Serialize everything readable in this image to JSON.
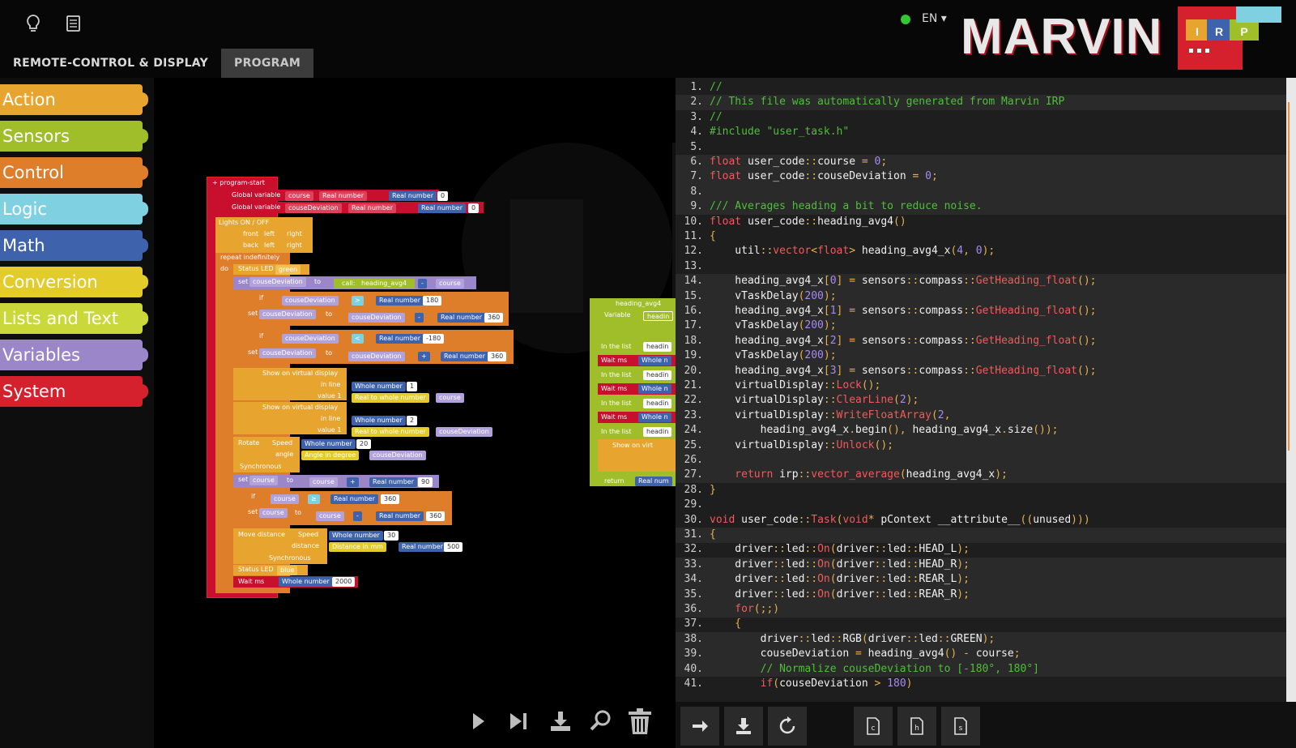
{
  "header": {
    "tabs": [
      {
        "label": "REMOTE-CONTROL & DISPLAY",
        "active": false
      },
      {
        "label": "PROGRAM",
        "active": true
      }
    ],
    "language": "EN",
    "connection_status_color": "#32c832",
    "logo_text": "MARVIN",
    "logo_badges": [
      "I",
      "R",
      "P"
    ],
    "icons": [
      "lightbulb-icon",
      "document-icon"
    ]
  },
  "palette": {
    "categories": [
      {
        "label": "Action",
        "color": "#e7a52f"
      },
      {
        "label": "Sensors",
        "color": "#9fbe2a"
      },
      {
        "label": "Control",
        "color": "#de7d2a"
      },
      {
        "label": "Logic",
        "color": "#7fd1e2"
      },
      {
        "label": "Math",
        "color": "#3f62ad"
      },
      {
        "label": "Conversion",
        "color": "#e3cc2a"
      },
      {
        "label": "Lists and Text",
        "color": "#cbd83a"
      },
      {
        "label": "Variables",
        "color": "#9a86c9"
      },
      {
        "label": "System",
        "color": "#d5212e"
      }
    ]
  },
  "blocks": {
    "program_start": "program-start",
    "global_var_label": "Global variable",
    "var_course": "course",
    "var_couse_dev": "couseDeviation",
    "real_number": "Real number",
    "zero": "0",
    "lights_on_off": "Lights ON / OFF",
    "front": "front",
    "back": "back",
    "left": "left",
    "right": "right",
    "repeat": "repeat indefinitely",
    "do": "do",
    "status_led": "Status LED",
    "green": "green",
    "blue": "blue",
    "set": "set",
    "to": "to",
    "call": "call:",
    "heading_avg4": "heading_avg4",
    "if": "if",
    "gt": ">",
    "lt": "<",
    "gte": "≥",
    "n180": "180",
    "n360": "360",
    "nm180": "-180",
    "n90": "90",
    "n20": "20",
    "n30": "30",
    "n500": "500",
    "n2000": "2000",
    "n1": "1",
    "n2": "2",
    "minus": "-",
    "plus": "+",
    "show_virtual": "Show on virtual display",
    "in_line": "in line",
    "value1": "value 1",
    "whole_number": "Whole number",
    "real_to_whole": "Real to whole number",
    "rotate": "Rotate",
    "speed": "Speed",
    "angle": "angle",
    "angle_deg": "Angle in degree",
    "synchronous": "Synchronous",
    "move_distance": "Move distance",
    "distance": "distance",
    "distance_mm": "Distance in mm",
    "wait_ms": "Wait ms",
    "variable": "Variable",
    "heading_short": "headin",
    "in_the_list": "In the list",
    "whole_short": "Whole n",
    "show_virt_short": "Show on virt",
    "return": "return",
    "real_num_short": "Real num"
  },
  "code": {
    "lines": [
      [
        [
          "c-cm",
          "//"
        ]
      ],
      [
        [
          "c-cm",
          "// This file was automatically generated from Marvin IRP"
        ]
      ],
      [
        [
          "c-cm",
          "//"
        ]
      ],
      [
        [
          "c-cm",
          "#include \"user_task.h\""
        ]
      ],
      [],
      [
        [
          "c-ty",
          "float"
        ],
        [
          "tx",
          " user_code"
        ],
        [
          "c-op",
          "::"
        ],
        [
          "tx",
          "course "
        ],
        [
          "c-op",
          "="
        ],
        [
          "tx",
          " "
        ],
        [
          "c-nu",
          "0"
        ],
        [
          "c-op",
          ";"
        ]
      ],
      [
        [
          "c-ty",
          "float"
        ],
        [
          "tx",
          " user_code"
        ],
        [
          "c-op",
          "::"
        ],
        [
          "tx",
          "couseDeviation "
        ],
        [
          "c-op",
          "="
        ],
        [
          "tx",
          " "
        ],
        [
          "c-nu",
          "0"
        ],
        [
          "c-op",
          ";"
        ]
      ],
      [],
      [
        [
          "c-cm",
          "/// Averages heading a bit to reduce noise."
        ]
      ],
      [
        [
          "c-ty",
          "float"
        ],
        [
          "tx",
          " user_code"
        ],
        [
          "c-op",
          "::"
        ],
        [
          "tx",
          "heading_avg4"
        ],
        [
          "c-op",
          "()"
        ]
      ],
      [
        [
          "c-op",
          "{"
        ]
      ],
      [
        [
          "tx",
          "    util"
        ],
        [
          "c-op",
          "::"
        ],
        [
          "c-fn",
          "vector"
        ],
        [
          "c-op",
          "<"
        ],
        [
          "c-ty",
          "float"
        ],
        [
          "c-op",
          ">"
        ],
        [
          "tx",
          " heading_avg4_x"
        ],
        [
          "c-op",
          "("
        ],
        [
          "c-nu",
          "4"
        ],
        [
          "c-op",
          ", "
        ],
        [
          "c-nu",
          "0"
        ],
        [
          "c-op",
          ");"
        ]
      ],
      [],
      [
        [
          "tx",
          "    heading_avg4_x"
        ],
        [
          "c-op",
          "["
        ],
        [
          "c-nu",
          "0"
        ],
        [
          "c-op",
          "]"
        ],
        [
          "tx",
          " "
        ],
        [
          "c-op",
          "="
        ],
        [
          "tx",
          " sensors"
        ],
        [
          "c-op",
          "::"
        ],
        [
          "tx",
          "compass"
        ],
        [
          "c-op",
          "::"
        ],
        [
          "c-fn",
          "GetHeading_float"
        ],
        [
          "c-op",
          "();"
        ]
      ],
      [
        [
          "tx",
          "    vTaskDelay"
        ],
        [
          "c-op",
          "("
        ],
        [
          "c-nu",
          "200"
        ],
        [
          "c-op",
          ");"
        ]
      ],
      [
        [
          "tx",
          "    heading_avg4_x"
        ],
        [
          "c-op",
          "["
        ],
        [
          "c-nu",
          "1"
        ],
        [
          "c-op",
          "]"
        ],
        [
          "tx",
          " "
        ],
        [
          "c-op",
          "="
        ],
        [
          "tx",
          " sensors"
        ],
        [
          "c-op",
          "::"
        ],
        [
          "tx",
          "compass"
        ],
        [
          "c-op",
          "::"
        ],
        [
          "c-fn",
          "GetHeading_float"
        ],
        [
          "c-op",
          "();"
        ]
      ],
      [
        [
          "tx",
          "    vTaskDelay"
        ],
        [
          "c-op",
          "("
        ],
        [
          "c-nu",
          "200"
        ],
        [
          "c-op",
          ");"
        ]
      ],
      [
        [
          "tx",
          "    heading_avg4_x"
        ],
        [
          "c-op",
          "["
        ],
        [
          "c-nu",
          "2"
        ],
        [
          "c-op",
          "]"
        ],
        [
          "tx",
          " "
        ],
        [
          "c-op",
          "="
        ],
        [
          "tx",
          " sensors"
        ],
        [
          "c-op",
          "::"
        ],
        [
          "tx",
          "compass"
        ],
        [
          "c-op",
          "::"
        ],
        [
          "c-fn",
          "GetHeading_float"
        ],
        [
          "c-op",
          "();"
        ]
      ],
      [
        [
          "tx",
          "    vTaskDelay"
        ],
        [
          "c-op",
          "("
        ],
        [
          "c-nu",
          "200"
        ],
        [
          "c-op",
          ");"
        ]
      ],
      [
        [
          "tx",
          "    heading_avg4_x"
        ],
        [
          "c-op",
          "["
        ],
        [
          "c-nu",
          "3"
        ],
        [
          "c-op",
          "]"
        ],
        [
          "tx",
          " "
        ],
        [
          "c-op",
          "="
        ],
        [
          "tx",
          " sensors"
        ],
        [
          "c-op",
          "::"
        ],
        [
          "tx",
          "compass"
        ],
        [
          "c-op",
          "::"
        ],
        [
          "c-fn",
          "GetHeading_float"
        ],
        [
          "c-op",
          "();"
        ]
      ],
      [
        [
          "tx",
          "    virtualDisplay"
        ],
        [
          "c-op",
          "::"
        ],
        [
          "c-fn",
          "Lock"
        ],
        [
          "c-op",
          "();"
        ]
      ],
      [
        [
          "tx",
          "    virtualDisplay"
        ],
        [
          "c-op",
          "::"
        ],
        [
          "c-fn",
          "ClearLine"
        ],
        [
          "c-op",
          "("
        ],
        [
          "c-nu",
          "2"
        ],
        [
          "c-op",
          ");"
        ]
      ],
      [
        [
          "tx",
          "    virtualDisplay"
        ],
        [
          "c-op",
          "::"
        ],
        [
          "c-fn",
          "WriteFloatArray"
        ],
        [
          "c-op",
          "("
        ],
        [
          "c-nu",
          "2"
        ],
        [
          "c-op",
          ","
        ]
      ],
      [
        [
          "tx",
          "        heading_avg4_x"
        ],
        [
          "c-op",
          "."
        ],
        [
          "tx",
          "begin"
        ],
        [
          "c-op",
          "(), "
        ],
        [
          "tx",
          "heading_avg4_x"
        ],
        [
          "c-op",
          "."
        ],
        [
          "tx",
          "size"
        ],
        [
          "c-op",
          "());"
        ]
      ],
      [
        [
          "tx",
          "    virtualDisplay"
        ],
        [
          "c-op",
          "::"
        ],
        [
          "c-fn",
          "Unlock"
        ],
        [
          "c-op",
          "();"
        ]
      ],
      [],
      [
        [
          "c-kw",
          "    return"
        ],
        [
          "tx",
          " irp"
        ],
        [
          "c-op",
          "::"
        ],
        [
          "c-fn",
          "vector_average"
        ],
        [
          "c-op",
          "("
        ],
        [
          "tx",
          "heading_avg4_x"
        ],
        [
          "c-op",
          ");"
        ]
      ],
      [
        [
          "c-op",
          "}"
        ]
      ],
      [],
      [
        [
          "c-ty",
          "void"
        ],
        [
          "tx",
          " user_code"
        ],
        [
          "c-op",
          "::"
        ],
        [
          "c-fn",
          "Task"
        ],
        [
          "c-op",
          "("
        ],
        [
          "c-ty",
          "void"
        ],
        [
          "c-op",
          "*"
        ],
        [
          "tx",
          " pContext __attribute__"
        ],
        [
          "c-op",
          "(("
        ],
        [
          "tx",
          "unused"
        ],
        [
          "c-op",
          ")))"
        ]
      ],
      [
        [
          "c-op",
          "{"
        ]
      ],
      [
        [
          "tx",
          "    driver"
        ],
        [
          "c-op",
          "::"
        ],
        [
          "tx",
          "led"
        ],
        [
          "c-op",
          "::"
        ],
        [
          "c-fn",
          "On"
        ],
        [
          "c-op",
          "("
        ],
        [
          "tx",
          "driver"
        ],
        [
          "c-op",
          "::"
        ],
        [
          "tx",
          "led"
        ],
        [
          "c-op",
          "::"
        ],
        [
          "tx",
          "HEAD_L"
        ],
        [
          "c-op",
          ");"
        ]
      ],
      [
        [
          "tx",
          "    driver"
        ],
        [
          "c-op",
          "::"
        ],
        [
          "tx",
          "led"
        ],
        [
          "c-op",
          "::"
        ],
        [
          "c-fn",
          "On"
        ],
        [
          "c-op",
          "("
        ],
        [
          "tx",
          "driver"
        ],
        [
          "c-op",
          "::"
        ],
        [
          "tx",
          "led"
        ],
        [
          "c-op",
          "::"
        ],
        [
          "tx",
          "HEAD_R"
        ],
        [
          "c-op",
          ");"
        ]
      ],
      [
        [
          "tx",
          "    driver"
        ],
        [
          "c-op",
          "::"
        ],
        [
          "tx",
          "led"
        ],
        [
          "c-op",
          "::"
        ],
        [
          "c-fn",
          "On"
        ],
        [
          "c-op",
          "("
        ],
        [
          "tx",
          "driver"
        ],
        [
          "c-op",
          "::"
        ],
        [
          "tx",
          "led"
        ],
        [
          "c-op",
          "::"
        ],
        [
          "tx",
          "REAR_L"
        ],
        [
          "c-op",
          ");"
        ]
      ],
      [
        [
          "tx",
          "    driver"
        ],
        [
          "c-op",
          "::"
        ],
        [
          "tx",
          "led"
        ],
        [
          "c-op",
          "::"
        ],
        [
          "c-fn",
          "On"
        ],
        [
          "c-op",
          "("
        ],
        [
          "tx",
          "driver"
        ],
        [
          "c-op",
          "::"
        ],
        [
          "tx",
          "led"
        ],
        [
          "c-op",
          "::"
        ],
        [
          "tx",
          "REAR_R"
        ],
        [
          "c-op",
          ");"
        ]
      ],
      [
        [
          "c-kw",
          "    for"
        ],
        [
          "c-op",
          "(;;)"
        ]
      ],
      [
        [
          "c-op",
          "    {"
        ]
      ],
      [
        [
          "tx",
          "        driver"
        ],
        [
          "c-op",
          "::"
        ],
        [
          "tx",
          "led"
        ],
        [
          "c-op",
          "::"
        ],
        [
          "tx",
          "RGB"
        ],
        [
          "c-op",
          "("
        ],
        [
          "tx",
          "driver"
        ],
        [
          "c-op",
          "::"
        ],
        [
          "tx",
          "led"
        ],
        [
          "c-op",
          "::"
        ],
        [
          "tx",
          "GREEN"
        ],
        [
          "c-op",
          ");"
        ]
      ],
      [
        [
          "tx",
          "        couseDeviation "
        ],
        [
          "c-op",
          "="
        ],
        [
          "tx",
          " heading_avg4"
        ],
        [
          "c-op",
          "()"
        ],
        [
          "tx",
          " "
        ],
        [
          "c-op",
          "-"
        ],
        [
          "tx",
          " course"
        ],
        [
          "c-op",
          ";"
        ]
      ],
      [
        [
          "c-cm",
          "        // Normalize couseDeviation to [-180°, 180°]"
        ]
      ],
      [
        [
          "c-kw",
          "        if"
        ],
        [
          "c-op",
          "("
        ],
        [
          "tx",
          "couseDeviation "
        ],
        [
          "c-op",
          ">"
        ],
        [
          "tx",
          " "
        ],
        [
          "c-nu",
          "180"
        ],
        [
          "c-op",
          ")"
        ]
      ]
    ]
  },
  "toolbars": {
    "workspace_buttons": [
      "play-icon",
      "step-icon",
      "download-icon",
      "search-icon",
      "trash-icon"
    ],
    "code_buttons": [
      "arrow-right-icon",
      "download-icon",
      "refresh-icon",
      "file-c-icon",
      "file-h-icon",
      "file-s-icon"
    ],
    "file_letters": [
      "c",
      "h",
      "s"
    ]
  }
}
